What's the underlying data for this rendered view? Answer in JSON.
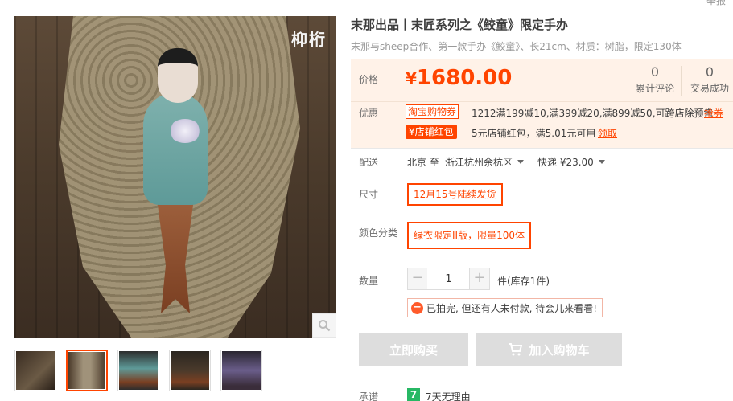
{
  "header": {
    "report_link": "举报"
  },
  "gallery": {
    "logo_text": "枊桁",
    "zoom_icon": "magnifier-icon",
    "thumbnails": [
      {
        "label": "thumb-1"
      },
      {
        "label": "thumb-2",
        "active": true
      },
      {
        "label": "thumb-3"
      },
      {
        "label": "thumb-4"
      },
      {
        "label": "thumb-5"
      }
    ]
  },
  "product": {
    "title": "末那出品丨末匠系列之《鲛童》限定手办",
    "subtitle": "末那与sheep合作、第一款手办《鲛童》、长21cm、材质：树脂，限定130体"
  },
  "price": {
    "label": "价格",
    "currency": "¥",
    "amount": "1680.00",
    "reviews_count": "0",
    "reviews_label": "累计评论",
    "sales_count": "0",
    "sales_label": "交易成功"
  },
  "promo": {
    "label": "优惠",
    "coupon_tag": "淘宝购物券",
    "coupon_text": "1212满199减10,满399减20,满899减50,可跨店除预售",
    "coupon_action": "抢券",
    "redpack_tag": "店铺红包",
    "redpack_text": "5元店铺红包，满5.01元可用",
    "redpack_action": "领取"
  },
  "shipping": {
    "label": "配送",
    "from": "北京 至",
    "to": "浙江杭州余杭区",
    "method": "快递 ¥23.00"
  },
  "size": {
    "label": "尺寸",
    "option": "12月15号陆续发货"
  },
  "color": {
    "label": "颜色分类",
    "option": "绿衣限定II版，限量100体"
  },
  "quantity": {
    "label": "数量",
    "value": "1",
    "minus": "−",
    "plus": "+",
    "stock": "件(库存1件)"
  },
  "warning": {
    "icon": "minus-circle-icon",
    "text": "已拍完, 但还有人未付款, 待会儿来看看!"
  },
  "actions": {
    "buy_now": "立即购买",
    "add_to_cart": "加入购物车"
  },
  "promise": {
    "label": "承诺",
    "icon_text": "7",
    "text": "7天无理由"
  },
  "colors": {
    "accent": "#ff4400",
    "price_bg": "#fff2e8",
    "disabled_btn": "#dddddd",
    "promise_green": "#27b864"
  }
}
